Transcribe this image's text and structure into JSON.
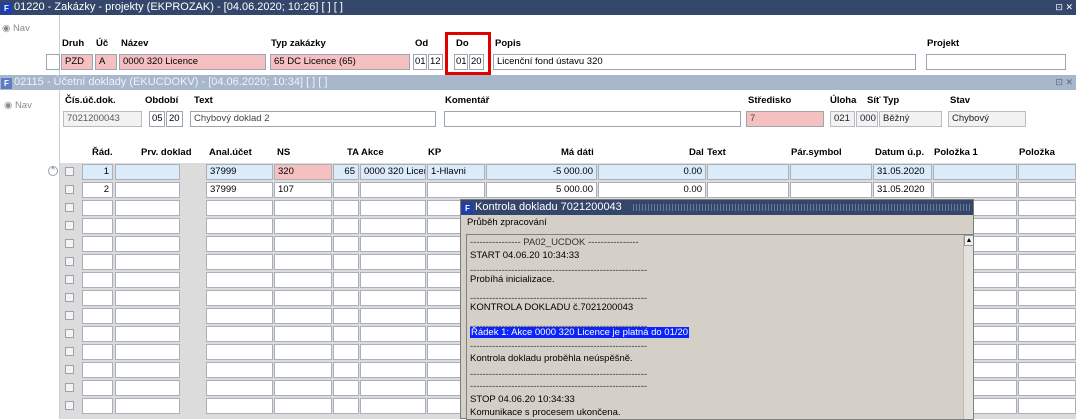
{
  "window1": {
    "title": "01220 - Zakázky - projekty (EKPROZAK) - [04.06.2020; 10:26]  [ ]  [ ]",
    "ctl": "⊡ ✕"
  },
  "nav_label": "Nav",
  "header_labels": {
    "druh": "Druh",
    "uc": "Úč",
    "nazev": "Název",
    "typ": "Typ zakázky",
    "od": "Od",
    "do": "Do",
    "popis": "Popis",
    "projekt": "Projekt"
  },
  "header_values": {
    "druh": "PZD",
    "uc": "A",
    "nazev": "0000 320 Licence",
    "typ": "65 DC Licence (65)",
    "od_m": "01",
    "od_y": "12",
    "do_m": "01",
    "do_y": "20",
    "popis": "Licenční fond ústavu 320",
    "projekt": ""
  },
  "window2": {
    "title": "02115 - Účetní doklady (EKUCDOKV) - [04.06.2020; 10:34]  [ ]  [ ]",
    "ctl": "⊡ ✕"
  },
  "doc_labels": {
    "cis": "Čís.úč.dok.",
    "obdobi": "Období",
    "text": "Text",
    "komentar": "Komentář",
    "stredisko": "Středisko",
    "uloha": "Úloha",
    "sit": "Síť",
    "typ": "Typ",
    "stav": "Stav"
  },
  "doc_values": {
    "cis": "7021200043",
    "obd_m": "05",
    "obd_y": "20",
    "text": "Chybový doklad 2",
    "komentar": "",
    "stredisko": "7",
    "uloha": "021",
    "sit": "000",
    "typ": "Běžný",
    "stav": "Chybový"
  },
  "grid_headers": {
    "rad": "Řád.",
    "prv": "Prv. doklad",
    "anal": "Anal.účet",
    "ns": "NS",
    "ta": "TA",
    "akce": "Akce",
    "kp": "KP",
    "madati": "Má dáti",
    "dal": "Dal",
    "text": "Text",
    "parsym": "Pár.symbol",
    "datum": "Datum ú.p.",
    "pol1": "Položka 1",
    "pol2": "Položka"
  },
  "rows": [
    {
      "rad": "1",
      "prv": "",
      "anal": "37999",
      "ns": "320",
      "ta": "65",
      "akce": "0000 320 Licen",
      "kp": "1-Hlavni",
      "madati": "-5 000.00",
      "dal": "0.00",
      "text": "",
      "parsym": "",
      "datum": "31.05.2020",
      "pol1": "",
      "pol2": ""
    },
    {
      "rad": "2",
      "prv": "",
      "anal": "37999",
      "ns": "107",
      "ta": "",
      "akce": "",
      "kp": "",
      "madati": "5 000.00",
      "dal": "0.00",
      "text": "",
      "parsym": "",
      "datum": "31.05.2020",
      "pol1": "",
      "pol2": ""
    }
  ],
  "dialog": {
    "title": "Kontrola dokladu 7021200043",
    "subtitle": "Průběh zpracování",
    "lines": [
      "---------------- PA02_UCDOK ----------------",
      "START 04.06.20 10:34:33",
      "--------------------------------------------------------",
      "Probíhá inicializace.",
      "--------------------------------------------------------",
      "KONTROLA DOKLADU č.7021200043",
      "--------------------------------------------------------",
      "Řádek 1: Akce 0000 320 Licence je platná do 01/20",
      "--------------------------------------------------------",
      "Kontrola dokladu proběhla neúspěšně.",
      "--------------------------------------------------------",
      "--------------------------------------------------------",
      "STOP 04.06.20 10:34:33",
      "Komunikace s procesem ukončena."
    ]
  },
  "colors": {
    "titlebar": "#34476b",
    "inactive_titlebar": "#a9b7cd",
    "pink": "#f6c0c0",
    "highlight": "#0b24fb",
    "red_box": "#e00000"
  }
}
